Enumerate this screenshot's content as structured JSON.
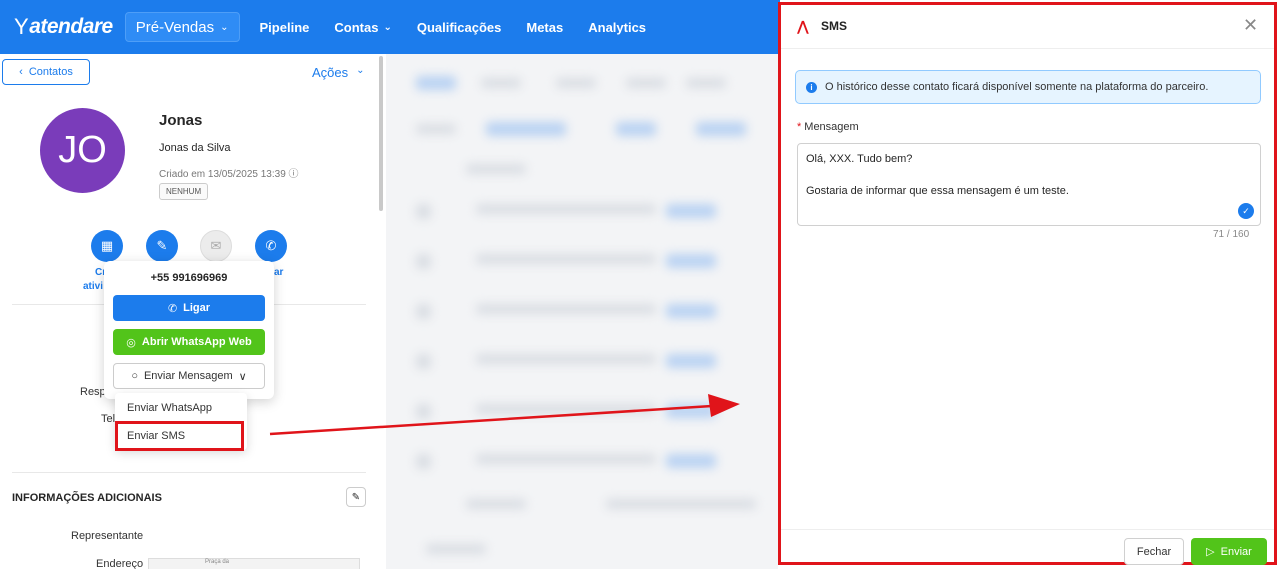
{
  "topbar": {
    "logo": "atendare",
    "workspace": "Pré-Vendas",
    "nav": [
      "Pipeline",
      "Contas",
      "Qualificações",
      "Metas",
      "Analytics"
    ]
  },
  "contact": {
    "back_label": "Contatos",
    "actions_label": "Ações",
    "initials": "JO",
    "name": "Jonas",
    "full_name": "Jonas da Silva",
    "created": "Criado em 13/05/2025 13:39",
    "tag": "NENHUM",
    "action_labels": {
      "create_activity_left": "Cr",
      "create_activity_left2": "ativi",
      "call_right": "ar"
    },
    "field_labels": {
      "responsavel": "Resp",
      "telefone": "Tel",
      "representante": "Representante",
      "endereco": "Endereço"
    },
    "additional_info_title": "INFORMAÇÕES ADICIONAIS",
    "map_label": "Praça da"
  },
  "popover": {
    "phone": "+55 991696969",
    "call_label": "Ligar",
    "whatsapp_label": "Abrir WhatsApp Web",
    "send_message_label": "Enviar Mensagem",
    "menu": [
      "Enviar WhatsApp",
      "Enviar SMS"
    ]
  },
  "modal": {
    "title": "SMS",
    "info": "O histórico desse contato ficará disponível somente na plataforma do parceiro.",
    "field_label": "Mensagem",
    "message": "Olá, XXX. Tudo bem?\n\nGostaria de informar que essa mensagem é um teste.",
    "counter": "71 / 160",
    "close_label": "Fechar",
    "send_label": "Enviar"
  },
  "colors": {
    "primary": "#1c7cec",
    "success": "#52c41a",
    "highlight": "#e0141a",
    "avatar": "#7a3cba"
  }
}
